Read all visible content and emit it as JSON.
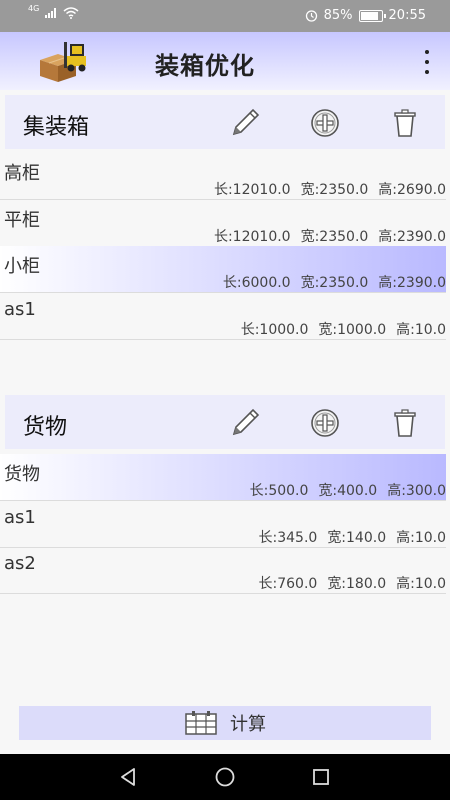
{
  "status_bar": {
    "signal": "4G",
    "alarm_icon": "alarm-icon",
    "battery_percent": "85%",
    "battery_level": 0.85,
    "time": "20:55"
  },
  "app_bar": {
    "title": "装箱优化",
    "logo_icon": "forklift-boxes-icon",
    "menu_icon": "more-vertical-icon"
  },
  "containers": {
    "title": "集装箱",
    "items": [
      {
        "name": "高柜",
        "len": "长:12010.0",
        "wid": "宽:2350.0",
        "hei": "高:2690.0",
        "selected": false
      },
      {
        "name": "平柜",
        "len": "长:12010.0",
        "wid": "宽:2350.0",
        "hei": "高:2390.0",
        "selected": false
      },
      {
        "name": "小柜",
        "len": "长:6000.0",
        "wid": "宽:2350.0",
        "hei": "高:2390.0",
        "selected": true
      },
      {
        "name": "as1",
        "len": "长:1000.0",
        "wid": "宽:1000.0",
        "hei": "高:10.0",
        "selected": false
      }
    ]
  },
  "cargo": {
    "title": "货物",
    "items": [
      {
        "name": "货物",
        "len": "长:500.0",
        "wid": "宽:400.0",
        "hei": "高:300.0",
        "selected": true
      },
      {
        "name": "as1",
        "len": "长:345.0",
        "wid": "宽:140.0",
        "hei": "高:10.0",
        "selected": false
      },
      {
        "name": "as2",
        "len": "长:760.0",
        "wid": "宽:180.0",
        "hei": "高:10.0",
        "selected": false
      }
    ]
  },
  "calc_button": {
    "label": "计算",
    "icon": "calculator-icon"
  },
  "colors": {
    "accent": "#b9b9ff",
    "header_bg": "#ececfb",
    "button_bg": "#dcdcfa"
  }
}
